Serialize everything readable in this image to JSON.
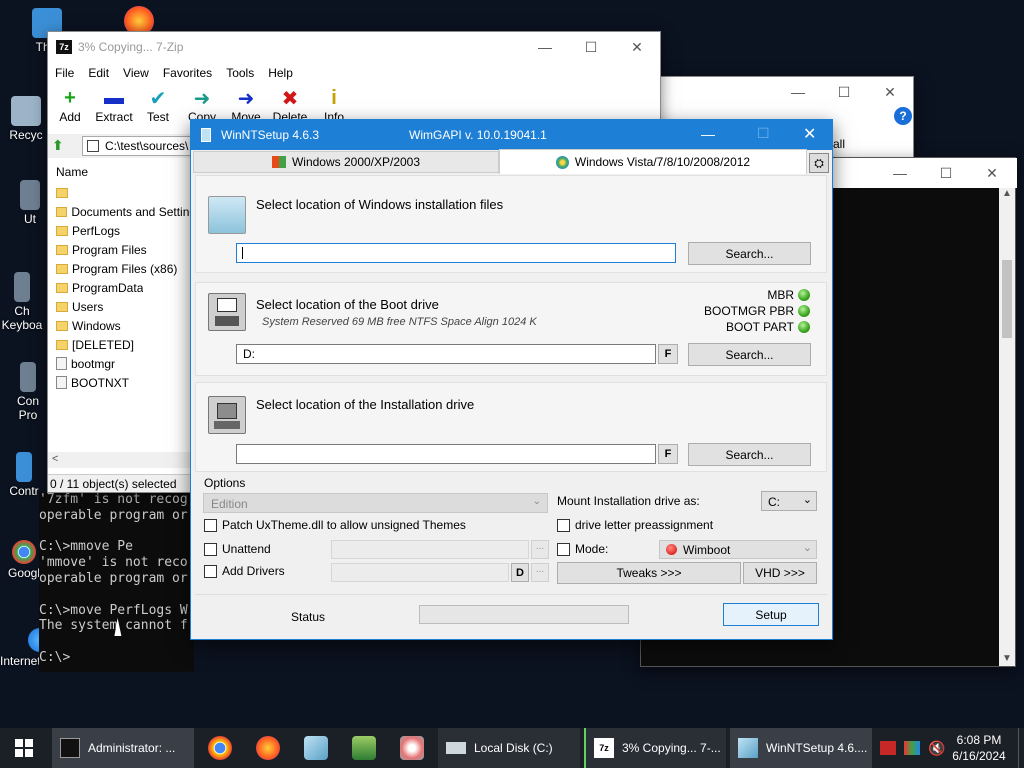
{
  "desktop": {
    "icons": [
      "This",
      "Recyc",
      "Ut",
      "Ch\nKeyboa",
      "Con\nPro",
      "Contr",
      "Googl",
      "Internet Explorer"
    ]
  },
  "sevenzip": {
    "title": "3% Copying... 7-Zip",
    "menu": [
      "File",
      "Edit",
      "View",
      "Favorites",
      "Tools",
      "Help"
    ],
    "tools": [
      {
        "label": "Add",
        "icon": "+",
        "color": "#1aa51a"
      },
      {
        "label": "Extract",
        "icon": "▬",
        "color": "#1530c8"
      },
      {
        "label": "Test",
        "icon": "✔",
        "color": "#1aa0b8"
      },
      {
        "label": "Copy",
        "icon": "➜",
        "color": "#1a9a8a"
      },
      {
        "label": "Move",
        "icon": "➜",
        "color": "#1530c8"
      },
      {
        "label": "Delete",
        "icon": "✖",
        "color": "#d01818"
      },
      {
        "label": "Info",
        "icon": "i",
        "color": "#c8a000"
      }
    ],
    "path": "C:\\test\\sources\\",
    "column_name": "Name",
    "files": [
      {
        "name": "",
        "type": "folder"
      },
      {
        "name": "Documents and Settings",
        "type": "folder"
      },
      {
        "name": "PerfLogs",
        "type": "folder"
      },
      {
        "name": "Program Files",
        "type": "folder"
      },
      {
        "name": "Program Files (x86)",
        "type": "folder"
      },
      {
        "name": "ProgramData",
        "type": "folder"
      },
      {
        "name": "Users",
        "type": "folder"
      },
      {
        "name": "Windows",
        "type": "folder"
      },
      {
        "name": "[DELETED]",
        "type": "folder"
      },
      {
        "name": "bootmgr",
        "type": "file"
      },
      {
        "name": "BOOTNXT",
        "type": "file"
      }
    ],
    "status": "0 / 11 object(s) selected"
  },
  "bgwin": {
    "title_partial": "all"
  },
  "cmd": {
    "lines": [
      "'7zfm' is not recog",
      "operable program or",
      "",
      "C:\\>mmove Pe",
      "'mmove' is not reco",
      "operable program or",
      "",
      "C:\\>move PerfLogs W",
      "The system cannot f",
      "",
      "C:\\>"
    ]
  },
  "wintn": {
    "title": "WinNTSetup 4.6.3",
    "api": "WimGAPI v. 10.0.19041.1",
    "tab_xp": "Windows 2000/XP/2003",
    "tab_vista": "Windows Vista/7/8/10/2008/2012",
    "sec1_title": "Select location of Windows installation files",
    "sec1_value": "",
    "search": "Search...",
    "sec2_title": "Select location of the Boot drive",
    "sec2_sub": "System Reserved 69 MB free NTFS Space Align 1024 K",
    "sec2_value": "D:",
    "f": "F",
    "status_mbr": "MBR",
    "status_pbr": "BOOTMGR PBR",
    "status_part": "BOOT PART",
    "sec3_title": "Select location of the Installation drive",
    "sec3_value": "",
    "options": "Options",
    "edition": "Edition",
    "mount_label": "Mount Installation drive as:",
    "mount_value": "C:",
    "patch": "Patch UxTheme.dll to allow unsigned Themes",
    "drive_assign": "drive letter preassignment",
    "unattend": "Unattend",
    "mode": "Mode:",
    "mode_value": "Wimboot",
    "add_drivers": "Add Drivers",
    "d": "D",
    "dots": "...",
    "tweaks": "Tweaks >>>",
    "vhd": "VHD >>>",
    "status": "Status",
    "setup": "Setup"
  },
  "taskbar": {
    "tasks": [
      {
        "label": "Administrator: ...",
        "state": "active"
      },
      {
        "label": "Local Disk (C:)",
        "state": "normal"
      },
      {
        "label": "3% Copying... 7-...",
        "state": "open"
      },
      {
        "label": "WinNTSetup 4.6....",
        "state": "active"
      }
    ],
    "time": "6:08 PM",
    "date": "6/16/2024"
  }
}
